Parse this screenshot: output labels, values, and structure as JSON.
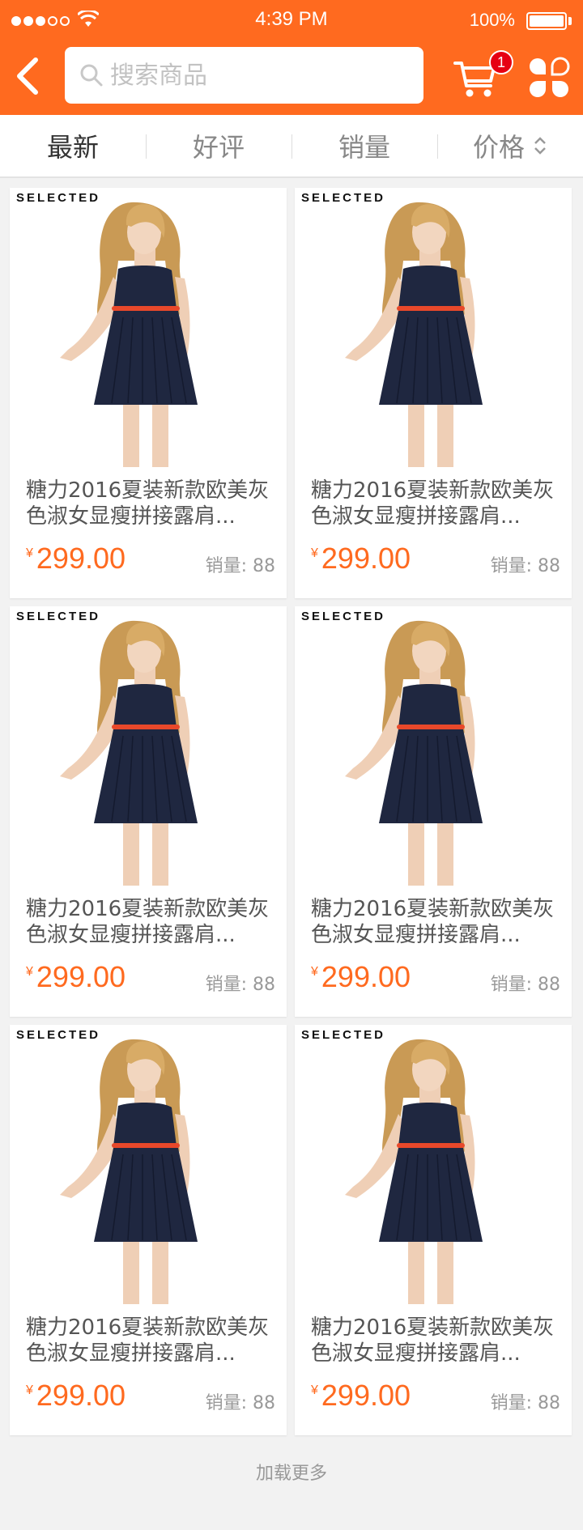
{
  "status_bar": {
    "time": "4:39 PM",
    "battery": "100%"
  },
  "header": {
    "search_placeholder": "搜索商品",
    "cart_badge": "1",
    "icons": {
      "back": "back-arrow-icon",
      "search": "search-icon",
      "cart": "cart-icon",
      "apps": "apps-icon"
    }
  },
  "tabs": [
    {
      "label": "最新",
      "active": true
    },
    {
      "label": "好评"
    },
    {
      "label": "销量"
    },
    {
      "label": "价格"
    }
  ],
  "products": [
    {
      "brand": "SELECTED",
      "title": "糖力2016夏装新款欧美灰色淑女显瘦拼接露肩...",
      "currency": "¥",
      "price": "299.00",
      "sales": "销量: 88"
    },
    {
      "brand": "SELECTED",
      "title": "糖力2016夏装新款欧美灰色淑女显瘦拼接露肩...",
      "currency": "¥",
      "price": "299.00",
      "sales": "销量: 88"
    },
    {
      "brand": "SELECTED",
      "title": "糖力2016夏装新款欧美灰色淑女显瘦拼接露肩...",
      "currency": "¥",
      "price": "299.00",
      "sales": "销量: 88"
    },
    {
      "brand": "SELECTED",
      "title": "糖力2016夏装新款欧美灰色淑女显瘦拼接露肩...",
      "currency": "¥",
      "price": "299.00",
      "sales": "销量: 88"
    },
    {
      "brand": "SELECTED",
      "title": "糖力2016夏装新款欧美灰色淑女显瘦拼接露肩...",
      "currency": "¥",
      "price": "299.00",
      "sales": "销量: 88"
    },
    {
      "brand": "SELECTED",
      "title": "糖力2016夏装新款欧美灰色淑女显瘦拼接露肩...",
      "currency": "¥",
      "price": "299.00",
      "sales": "销量: 88"
    }
  ],
  "load_more": "加载更多",
  "colors": {
    "brand": "#ff6a1f",
    "badge": "#e60012",
    "dress": "#1f2740",
    "belt": "#e8482a"
  }
}
